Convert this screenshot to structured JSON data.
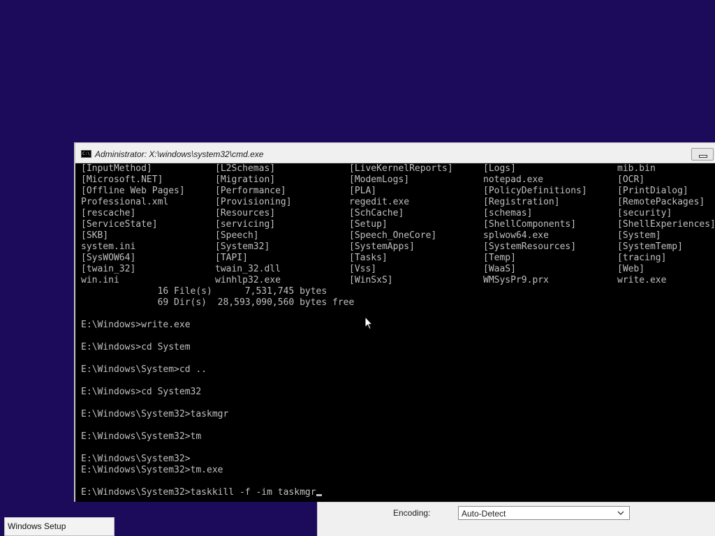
{
  "window": {
    "title": "Administrator: X:\\windows\\system32\\cmd.exe",
    "icon": "C:\\",
    "icon_name": "cmd-icon"
  },
  "listing": [
    [
      "[InputMethod]",
      "[L2Schemas]",
      "[LiveKernelReports]",
      "[Logs]",
      "mib.bin"
    ],
    [
      "[Microsoft.NET]",
      "[Migration]",
      "[ModemLogs]",
      "notepad.exe",
      "[OCR]"
    ],
    [
      "[Offline Web Pages]",
      "[Performance]",
      "[PLA]",
      "[PolicyDefinitions]",
      "[PrintDialog]"
    ],
    [
      "Professional.xml",
      "[Provisioning]",
      "regedit.exe",
      "[Registration]",
      "[RemotePackages]"
    ],
    [
      "[rescache]",
      "[Resources]",
      "[SchCache]",
      "[schemas]",
      "[security]"
    ],
    [
      "[ServiceState]",
      "[servicing]",
      "[Setup]",
      "[ShellComponents]",
      "[ShellExperiences]"
    ],
    [
      "[SKB]",
      "[Speech]",
      "[Speech_OneCore]",
      "splwow64.exe",
      "[System]"
    ],
    [
      "system.ini",
      "[System32]",
      "[SystemApps]",
      "[SystemResources]",
      "[SystemTemp]"
    ],
    [
      "[SysWOW64]",
      "[TAPI]",
      "[Tasks]",
      "[Temp]",
      "[tracing]"
    ],
    [
      "[twain_32]",
      "twain_32.dll",
      "[Vss]",
      "[WaaS]",
      "[Web]"
    ],
    [
      "win.ini",
      "winhlp32.exe",
      "[WinSxS]",
      "WMSysPr9.prx",
      "write.exe"
    ]
  ],
  "summary": [
    "              16 File(s)      7,531,745 bytes",
    "              69 Dir(s)  28,593,090,560 bytes free"
  ],
  "history": [
    "",
    "E:\\Windows>write.exe",
    "",
    "E:\\Windows>cd System",
    "",
    "E:\\Windows\\System>cd ..",
    "",
    "E:\\Windows>cd System32",
    "",
    "E:\\Windows\\System32>taskmgr",
    "",
    "E:\\Windows\\System32>tm",
    "",
    "E:\\Windows\\System32>",
    "E:\\Windows\\System32>tm.exe",
    ""
  ],
  "prompt": {
    "text": "E:\\Windows\\System32>taskkill -f -im taskmgr"
  },
  "encoding": {
    "label": "Encoding:",
    "value": "Auto-Detect"
  },
  "taskbar": {
    "item_label": "Windows Setup"
  },
  "colors": {
    "desktop": "#1c0a5b",
    "console_bg": "#000000",
    "console_text": "#c0c0c0"
  }
}
